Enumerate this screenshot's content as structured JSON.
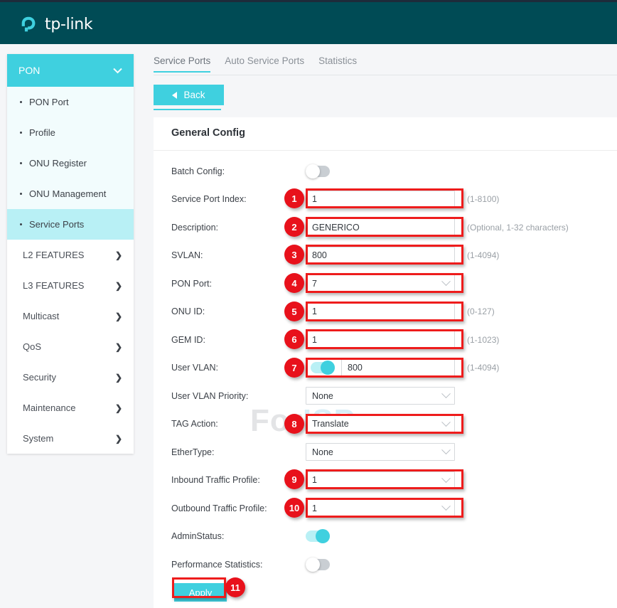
{
  "header": {
    "brand": "tp-link",
    "logo_icon": "tplink-logo-icon"
  },
  "sidebar": {
    "menu_title": "PON",
    "menu_chevron_icon": "chevron-down-icon",
    "sub_items": [
      {
        "label": "PON Port",
        "active": false
      },
      {
        "label": "Profile",
        "active": false
      },
      {
        "label": "ONU Register",
        "active": false
      },
      {
        "label": "ONU Management",
        "active": false
      },
      {
        "label": "Service Ports",
        "active": true
      }
    ],
    "groups": [
      {
        "label": "L2 FEATURES",
        "arrow_icon": "chevron-right-icon"
      },
      {
        "label": "L3 FEATURES",
        "arrow_icon": "chevron-right-icon"
      },
      {
        "label": "Multicast",
        "arrow_icon": "chevron-right-icon"
      },
      {
        "label": "QoS",
        "arrow_icon": "chevron-right-icon"
      },
      {
        "label": "Security",
        "arrow_icon": "chevron-right-icon"
      },
      {
        "label": "Maintenance",
        "arrow_icon": "chevron-right-icon"
      },
      {
        "label": "System",
        "arrow_icon": "chevron-right-icon"
      }
    ]
  },
  "tabs": [
    {
      "label": "Service Ports",
      "active": true
    },
    {
      "label": "Auto Service Ports",
      "active": false
    },
    {
      "label": "Statistics",
      "active": false
    }
  ],
  "toolbar": {
    "back_label": "Back",
    "back_icon": "triangle-left-icon"
  },
  "panel": {
    "title": "General Config",
    "watermark_part1": "For",
    "watermark_part2": "ISP"
  },
  "form": {
    "batch_config": {
      "label": "Batch Config:",
      "state": "off"
    },
    "service_port_index": {
      "label": "Service Port Index:",
      "value": "1",
      "hint": "(1-8100)"
    },
    "description": {
      "label": "Description:",
      "value": "GENERICO",
      "hint": "(Optional, 1-32 characters)"
    },
    "svlan": {
      "label": "SVLAN:",
      "value": "800",
      "hint": "(1-4094)"
    },
    "pon_port": {
      "label": "PON Port:",
      "value": "7",
      "hint": ""
    },
    "onu_id": {
      "label": "ONU ID:",
      "value": "1",
      "hint": "(0-127)"
    },
    "gem_id": {
      "label": "GEM ID:",
      "value": "1",
      "hint": "(1-1023)"
    },
    "user_vlan": {
      "label": "User VLAN:",
      "toggle_state": "on",
      "value": "800",
      "hint": "(1-4094)"
    },
    "user_vlan_priority": {
      "label": "User VLAN Priority:",
      "value": "None"
    },
    "tag_action": {
      "label": "TAG Action:",
      "value": "Translate"
    },
    "ethertype": {
      "label": "EtherType:",
      "value": "None"
    },
    "inbound_traffic_profile": {
      "label": "Inbound Traffic Profile:",
      "value": "1"
    },
    "outbound_traffic_profile": {
      "label": "Outbound Traffic Profile:",
      "value": "1"
    },
    "admin_status": {
      "label": "AdminStatus:",
      "state": "on"
    },
    "performance_statistics": {
      "label": "Performance Statistics:",
      "state": "off"
    },
    "apply_label": "Apply"
  },
  "annotations": {
    "badges": [
      "1",
      "2",
      "3",
      "4",
      "5",
      "6",
      "7",
      "8",
      "9",
      "10",
      "11"
    ]
  },
  "colors": {
    "brand_dark": "#004b55",
    "accent_cyan": "#3fd0df",
    "annotation_red": "#e8111b",
    "submenu_bg": "#f2fcfd",
    "active_item_bg": "#b8f0f5"
  }
}
